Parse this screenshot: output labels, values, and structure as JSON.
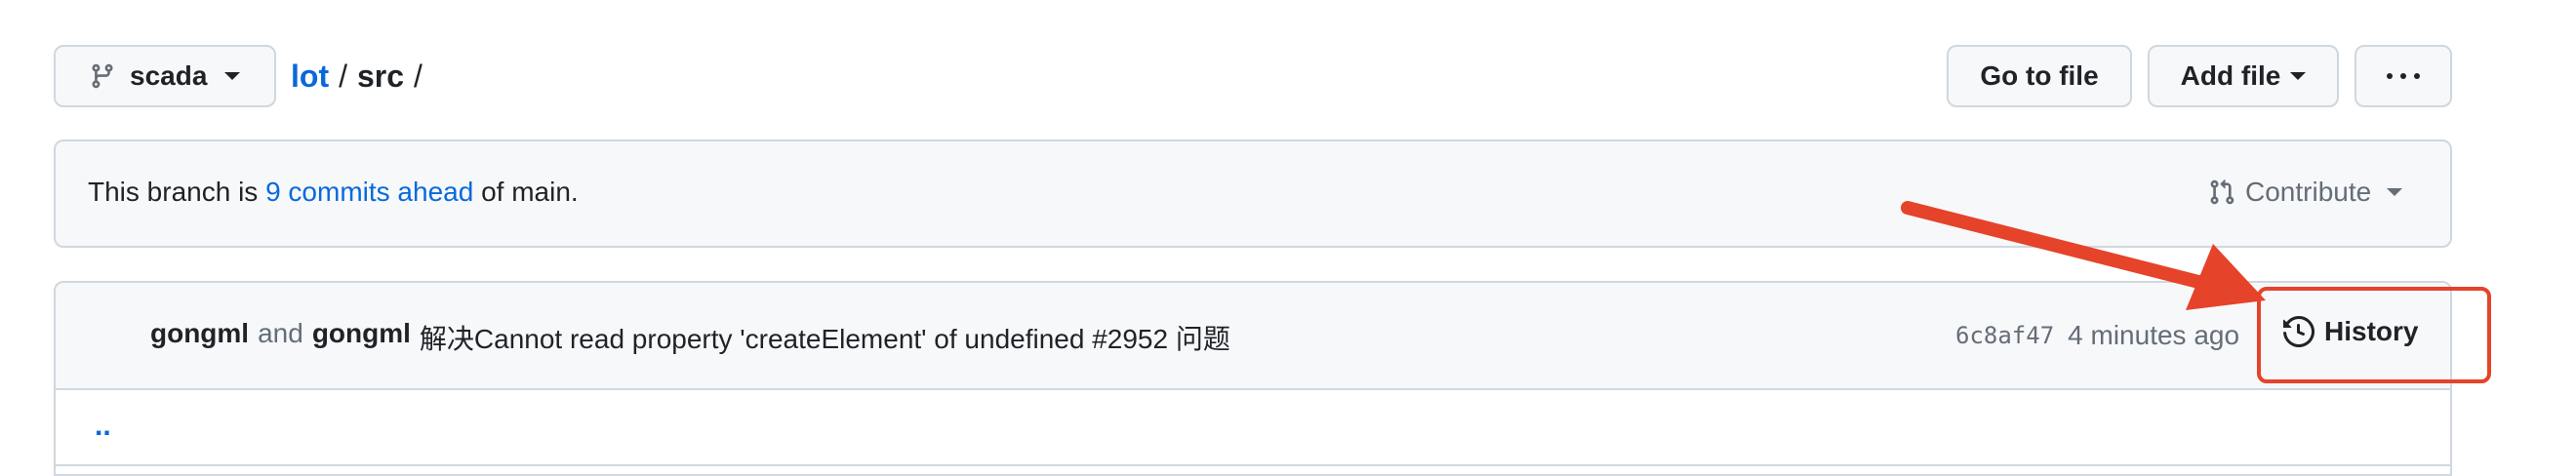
{
  "branch": {
    "name": "scada",
    "icon": "git-branch-icon"
  },
  "breadcrumb": {
    "repo": "lot",
    "sep1": "/",
    "folder": "src",
    "sep2": "/"
  },
  "actions": {
    "go_to_file": "Go to file",
    "add_file": "Add file",
    "more_icon": "kebab-horizontal-icon"
  },
  "banner": {
    "prefix": "This branch is ",
    "link": "9 commits ahead",
    "suffix": " of main.",
    "contribute": "Contribute",
    "contribute_icon": "git-pull-request-icon"
  },
  "commit": {
    "author1": "gongml",
    "conjunction": "and",
    "author2": "gongml",
    "message": "解决Cannot read property 'createElement' of undefined #2952 问题",
    "sha": "6c8af47",
    "time": "4 minutes ago",
    "history": "History",
    "history_icon": "history-icon"
  },
  "file_list": {
    "parent": ".."
  },
  "annotation": {
    "color": "#e5432a",
    "arrow": "pointer-arrow",
    "box": "highlight-box"
  },
  "colors": {
    "accent": "#0969da",
    "border": "#d0d7de",
    "button_bg": "#f6f8fa",
    "text": "#1f2328",
    "muted": "#656d76"
  }
}
